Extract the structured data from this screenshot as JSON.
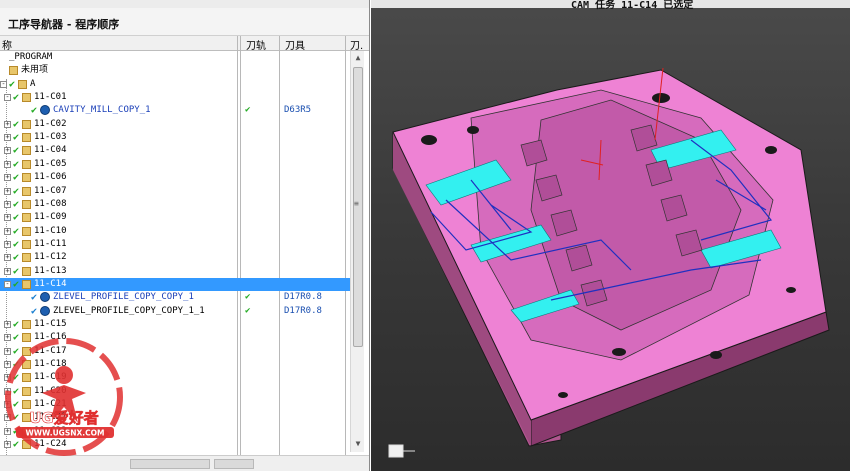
{
  "window": {
    "nav_title": "工序导航器 - 程序顺序",
    "status_text": "CAM 任务 11-C14 已选定"
  },
  "columns": {
    "name": "称",
    "toolpath": "刀轨",
    "tool": "刀具",
    "extra": "刀."
  },
  "tree": [
    {
      "label": "_PROGRAM",
      "level": 0,
      "exp": "",
      "check": "",
      "icon": "none",
      "path": "",
      "tool": ""
    },
    {
      "label": "未用项",
      "level": 0,
      "exp": "",
      "check": "",
      "icon": "folder",
      "path": "",
      "tool": ""
    },
    {
      "label": "A",
      "level": 0,
      "exp": "-",
      "check": "green",
      "icon": "folder",
      "path": "",
      "tool": ""
    },
    {
      "label": "11-C01",
      "level": 1,
      "exp": "-",
      "check": "green",
      "icon": "folder",
      "path": "",
      "tool": ""
    },
    {
      "label": "CAVITY_MILL_COPY_1",
      "level": 2,
      "exp": "",
      "check": "green",
      "icon": "op",
      "path": "✔",
      "tool": "D63R5",
      "blue": true
    },
    {
      "label": "11-C02",
      "level": 1,
      "exp": "+",
      "check": "green",
      "icon": "folder",
      "path": "",
      "tool": ""
    },
    {
      "label": "11-C03",
      "level": 1,
      "exp": "+",
      "check": "green",
      "icon": "folder",
      "path": "",
      "tool": ""
    },
    {
      "label": "11-C04",
      "level": 1,
      "exp": "+",
      "check": "green",
      "icon": "folder",
      "path": "",
      "tool": ""
    },
    {
      "label": "11-C05",
      "level": 1,
      "exp": "+",
      "check": "green",
      "icon": "folder",
      "path": "",
      "tool": ""
    },
    {
      "label": "11-C06",
      "level": 1,
      "exp": "+",
      "check": "green",
      "icon": "folder",
      "path": "",
      "tool": ""
    },
    {
      "label": "11-C07",
      "level": 1,
      "exp": "+",
      "check": "green",
      "icon": "folder",
      "path": "",
      "tool": ""
    },
    {
      "label": "11-C08",
      "level": 1,
      "exp": "+",
      "check": "green",
      "icon": "folder",
      "path": "",
      "tool": ""
    },
    {
      "label": "11-C09",
      "level": 1,
      "exp": "+",
      "check": "green",
      "icon": "folder",
      "path": "",
      "tool": ""
    },
    {
      "label": "11-C10",
      "level": 1,
      "exp": "+",
      "check": "green",
      "icon": "folder",
      "path": "",
      "tool": ""
    },
    {
      "label": "11-C11",
      "level": 1,
      "exp": "+",
      "check": "green",
      "icon": "folder",
      "path": "",
      "tool": ""
    },
    {
      "label": "11-C12",
      "level": 1,
      "exp": "+",
      "check": "green",
      "icon": "folder",
      "path": "",
      "tool": ""
    },
    {
      "label": "11-C13",
      "level": 1,
      "exp": "+",
      "check": "green",
      "icon": "folder",
      "path": "",
      "tool": ""
    },
    {
      "label": "11-C14",
      "level": 1,
      "exp": "-",
      "check": "green",
      "icon": "folder",
      "path": "",
      "tool": "",
      "selected": true
    },
    {
      "label": "ZLEVEL_PROFILE_COPY_COPY_1",
      "level": 2,
      "exp": "",
      "check": "blue",
      "icon": "op",
      "path": "✔",
      "tool": "D17R0.8",
      "blue": true
    },
    {
      "label": "ZLEVEL_PROFILE_COPY_COPY_1_1",
      "level": 2,
      "exp": "",
      "check": "blue",
      "icon": "op",
      "path": "✔",
      "tool": "D17R0.8"
    },
    {
      "label": "11-C15",
      "level": 1,
      "exp": "+",
      "check": "green",
      "icon": "folder",
      "path": "",
      "tool": ""
    },
    {
      "label": "11-C16",
      "level": 1,
      "exp": "+",
      "check": "green",
      "icon": "folder",
      "path": "",
      "tool": ""
    },
    {
      "label": "11-C17",
      "level": 1,
      "exp": "+",
      "check": "green",
      "icon": "folder",
      "path": "",
      "tool": ""
    },
    {
      "label": "11-C18",
      "level": 1,
      "exp": "+",
      "check": "green",
      "icon": "folder",
      "path": "",
      "tool": ""
    },
    {
      "label": "11-C19",
      "level": 1,
      "exp": "+",
      "check": "green",
      "icon": "folder",
      "path": "",
      "tool": ""
    },
    {
      "label": "11-C20",
      "level": 1,
      "exp": "+",
      "check": "green",
      "icon": "folder",
      "path": "",
      "tool": ""
    },
    {
      "label": "11-C21",
      "level": 1,
      "exp": "+",
      "check": "green",
      "icon": "folder",
      "path": "",
      "tool": ""
    },
    {
      "label": "11-C22",
      "level": 1,
      "exp": "+",
      "check": "green",
      "icon": "folder",
      "path": "",
      "tool": ""
    },
    {
      "label": "11-C23",
      "level": 1,
      "exp": "+",
      "check": "green",
      "icon": "folder",
      "path": "",
      "tool": ""
    },
    {
      "label": "11-C24",
      "level": 1,
      "exp": "+",
      "check": "green",
      "icon": "folder",
      "path": "",
      "tool": ""
    }
  ],
  "watermark": {
    "brand": "UG爱好者",
    "url": "WWW.UGSNX.COM"
  },
  "colors": {
    "selection": "#3399ff",
    "part_pink": "#ee82d4",
    "part_cyan": "#33f0f0",
    "toolpath_blue": "#2030c0",
    "check_green": "#22aa22"
  },
  "icons": [
    "expand-icon",
    "collapse-icon",
    "checkmark-icon",
    "folder-icon",
    "operation-icon",
    "scroll-up-icon",
    "scroll-down-icon"
  ]
}
